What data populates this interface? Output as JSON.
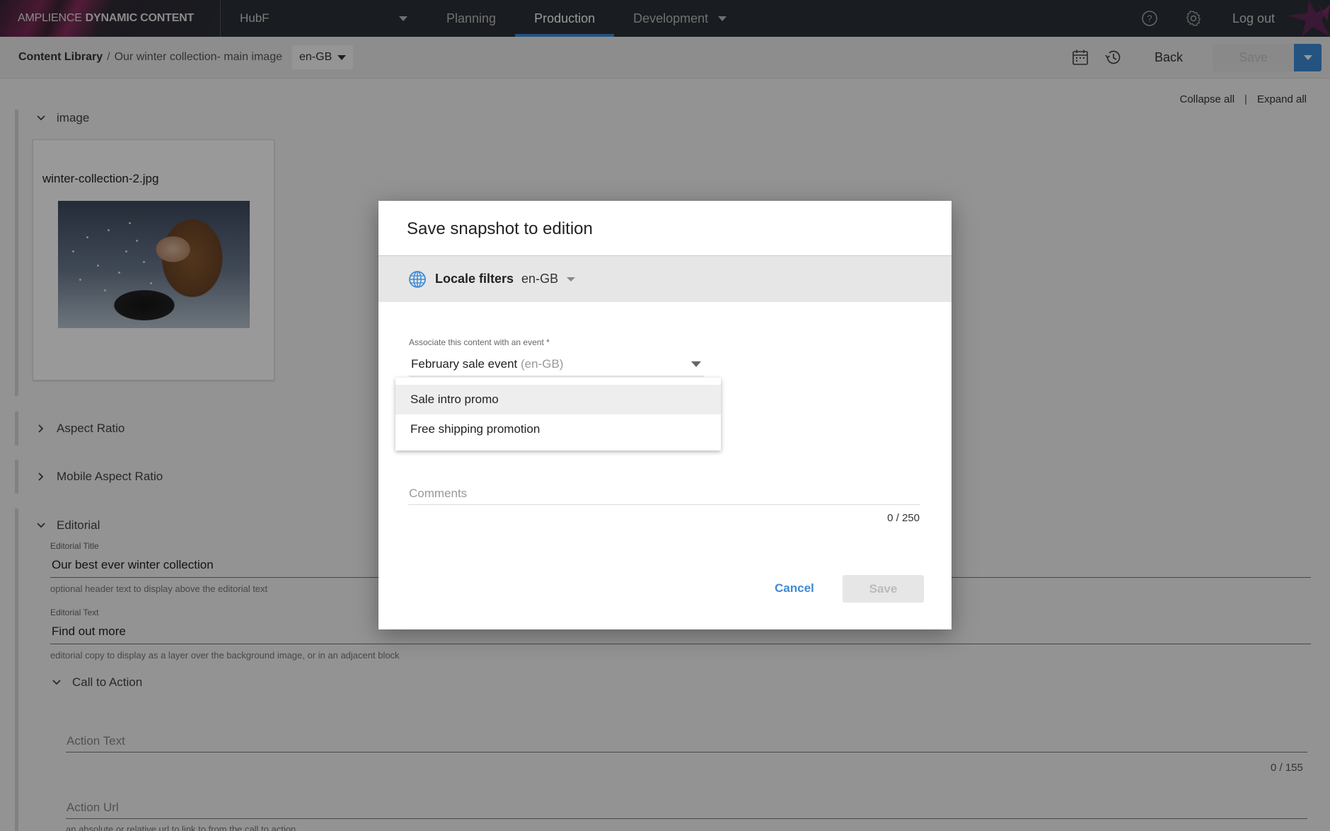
{
  "topnav": {
    "brand_light": "AMPLIENCE",
    "brand_bold": "DYNAMIC CONTENT",
    "hub": "HubF",
    "tabs": [
      {
        "label": "Planning",
        "active": false
      },
      {
        "label": "Production",
        "active": true
      },
      {
        "label": "Development",
        "active": false
      }
    ],
    "logout": "Log out",
    "help_icon": "help-circle-icon",
    "settings_icon": "gear-icon"
  },
  "subheader": {
    "breadcrumb_root": "Content Library",
    "breadcrumb_sep": "/",
    "breadcrumb_current": "Our winter collection- main image",
    "locale": "en-GB",
    "back": "Back",
    "save": "Save",
    "calendar_icon": "calendar-icon",
    "history_icon": "history-icon"
  },
  "content": {
    "collapse_all": "Collapse all",
    "pipe": "|",
    "expand_all": "Expand all",
    "image_section": {
      "label": "image",
      "filename": "winter-collection-2.jpg"
    },
    "aspect_ratio": "Aspect Ratio",
    "mobile_aspect_ratio": "Mobile Aspect Ratio",
    "editorial": {
      "label": "Editorial",
      "title_label": "Editorial Title",
      "title_value": "Our best ever winter collection",
      "title_help": "optional header text to display above the editorial text",
      "text_label": "Editorial Text",
      "text_value": "Find out more",
      "text_help": "editorial copy to display as a layer over the background image, or in an adjacent block",
      "cta": {
        "label": "Call to Action",
        "action_text_placeholder": "Action Text",
        "action_text_count": "0 / 155",
        "action_url_placeholder": "Action Url",
        "action_url_help": "an absolute or relative url to link to from the call to action"
      }
    }
  },
  "modal": {
    "title": "Save snapshot to edition",
    "locale_filters_label": "Locale filters",
    "locale_filters_value": "en-GB",
    "event_label": "Associate this content with an event *",
    "event_value": "February sale event",
    "event_locale": "(en-GB)",
    "dropdown_options": [
      "Sale intro promo",
      "Free shipping promotion"
    ],
    "comments_placeholder": "Comments",
    "comments_count": "0 / 250",
    "cancel": "Cancel",
    "save": "Save"
  },
  "colors": {
    "accent": "#3d8ad6",
    "nav_bg": "#2b2f36",
    "overlay": "rgba(0,0,0,0.4)"
  }
}
